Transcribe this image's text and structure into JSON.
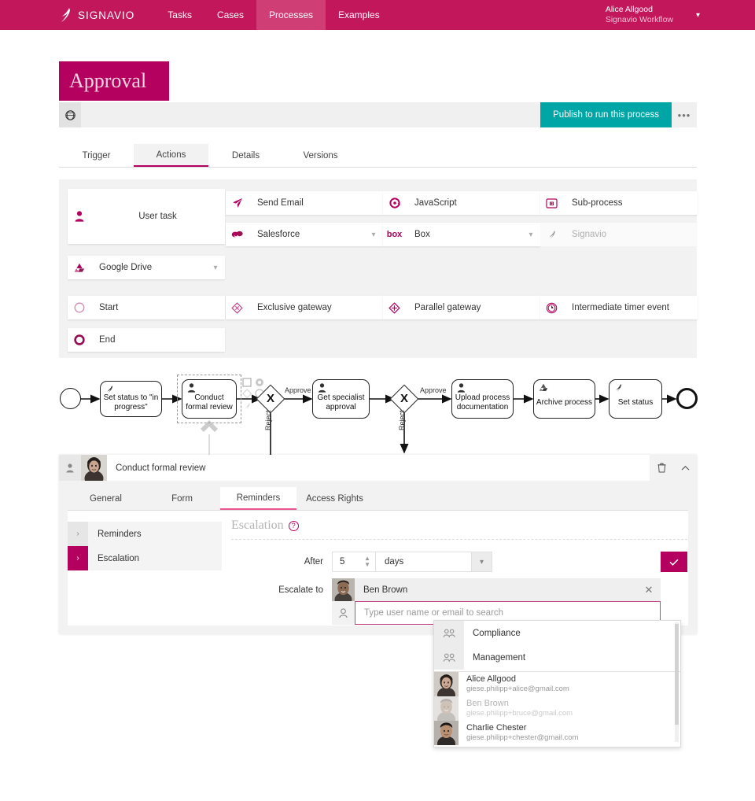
{
  "topnav": {
    "brand": "SIGNAVIO",
    "brand_logo_icon": "signavio-logo-icon",
    "items": [
      {
        "label": "Tasks",
        "active": false
      },
      {
        "label": "Cases",
        "active": false
      },
      {
        "label": "Processes",
        "active": true
      },
      {
        "label": "Examples",
        "active": false
      }
    ],
    "user_name": "Alice Allgood",
    "user_org": "Signavio Workflow",
    "caret_icon": "chevron-down-icon",
    "accent_color": "#c2185b"
  },
  "page": {
    "title": "Approval",
    "title_bg": "#b4005e"
  },
  "action_bar": {
    "globe_icon": "globe-icon",
    "publish_label": "Publish to run this process",
    "publish_color": "#00a6a6",
    "more_label": "•••"
  },
  "tabs": [
    {
      "label": "Trigger",
      "active": false
    },
    {
      "label": "Actions",
      "active": true
    },
    {
      "label": "Details",
      "active": false
    },
    {
      "label": "Versions",
      "active": false
    }
  ],
  "palette": {
    "user_task": {
      "label": "User task",
      "icon": "user-task-icon"
    },
    "google_drive": {
      "label": "Google Drive",
      "icon": "google-drive-icon",
      "caret": "chevron-down-icon"
    },
    "items": [
      {
        "label": "Send Email",
        "icon": "send-email-icon",
        "caret": null,
        "disabled": false
      },
      {
        "label": "JavaScript",
        "icon": "javascript-icon",
        "caret": null,
        "disabled": false
      },
      {
        "label": "Sub-process",
        "icon": "sub-process-icon",
        "caret": null,
        "disabled": false
      },
      {
        "label": "Salesforce",
        "icon": "salesforce-icon",
        "caret": "chevron-down-icon",
        "disabled": false
      },
      {
        "label": "Box",
        "icon": "box-icon",
        "caret": "chevron-down-icon",
        "disabled": false
      },
      {
        "label": "Signavio",
        "icon": "signavio-icon",
        "caret": null,
        "disabled": true
      }
    ],
    "events": [
      {
        "label": "Start",
        "icon": "start-event-icon"
      },
      {
        "label": "Exclusive gateway",
        "icon": "exclusive-gateway-icon"
      },
      {
        "label": "Parallel gateway",
        "icon": "parallel-gateway-icon"
      },
      {
        "label": "Intermediate timer event",
        "icon": "intermediate-timer-event-icon"
      },
      {
        "label": "End",
        "icon": "end-event-icon"
      }
    ]
  },
  "diagram": {
    "nodes": [
      {
        "id": "start",
        "type": "start-event",
        "label": ""
      },
      {
        "id": "set-status-progress",
        "type": "service-task",
        "label": "Set status to \"in progress\"",
        "icon": "signavio-task-icon"
      },
      {
        "id": "conduct-formal-review",
        "type": "user-task",
        "label": "Conduct formal review",
        "icon": "user-task-icon",
        "selected": true
      },
      {
        "id": "gateway-1",
        "type": "exclusive-gateway",
        "label": ""
      },
      {
        "id": "get-specialist-approval",
        "type": "user-task",
        "label": "Get specialist approval",
        "icon": "user-task-icon"
      },
      {
        "id": "gateway-2",
        "type": "exclusive-gateway",
        "label": ""
      },
      {
        "id": "upload-process-documentation",
        "type": "user-task",
        "label": "Upload process documentation",
        "icon": "user-task-icon"
      },
      {
        "id": "archive-process",
        "type": "service-task",
        "label": "Archive process",
        "icon": "google-drive-icon"
      },
      {
        "id": "set-status",
        "type": "service-task",
        "label": "Set status",
        "icon": "signavio-task-icon"
      },
      {
        "id": "end",
        "type": "end-event",
        "label": ""
      }
    ],
    "flow_labels": [
      "Approve",
      "Reject",
      "Approve",
      "Reject"
    ],
    "context_icons": [
      "square-icon",
      "circle-icon",
      "diamond-icon",
      "circle-outline-icon",
      "wrench-icon"
    ]
  },
  "lower_panel": {
    "header": {
      "type_icon": "user-task-icon",
      "avatar": "alice-avatar",
      "title": "Conduct formal review",
      "delete_icon": "trash-icon",
      "collapse_icon": "chevron-up-icon"
    },
    "tabs": [
      {
        "label": "General",
        "active": false
      },
      {
        "label": "Form",
        "active": false
      },
      {
        "label": "Reminders",
        "active": true
      },
      {
        "label": "Access Rights",
        "active": false
      }
    ],
    "side_items": [
      {
        "label": "Reminders",
        "selected": false,
        "arrow": "chevron-right-icon"
      },
      {
        "label": "Escalation",
        "selected": true,
        "arrow": "chevron-right-icon"
      }
    ],
    "form": {
      "heading": "Escalation",
      "help_icon": "help-icon",
      "help_glyph": "?",
      "after_label": "After",
      "after_value": "5",
      "spinner_icon": "spinner-icon",
      "unit_value": "days",
      "unit_caret": "chevron-down-icon",
      "confirm_icon": "check-icon",
      "escalate_label": "Escalate to",
      "assignee_name": "Ben Brown",
      "assignee_avatar": "ben-avatar",
      "remove_icon": "close-icon",
      "search_icon": "user-search-icon",
      "search_placeholder": "Type user name or email to search",
      "search_value": ""
    }
  },
  "dropdown": {
    "groups": [
      {
        "label": "Compliance",
        "icon": "group-icon"
      },
      {
        "label": "Management",
        "icon": "group-icon"
      }
    ],
    "users": [
      {
        "name": "Alice Allgood",
        "email": "giese.philipp+alice@gmail.com",
        "avatar": "alice-avatar",
        "disabled": false
      },
      {
        "name": "Ben Brown",
        "email": "giese.philipp+bruce@gmail.com",
        "avatar": "ben-avatar",
        "disabled": true
      },
      {
        "name": "Charlie Chester",
        "email": "giese.philipp+chester@gmail.com",
        "avatar": "charlie-avatar",
        "disabled": false
      }
    ]
  }
}
